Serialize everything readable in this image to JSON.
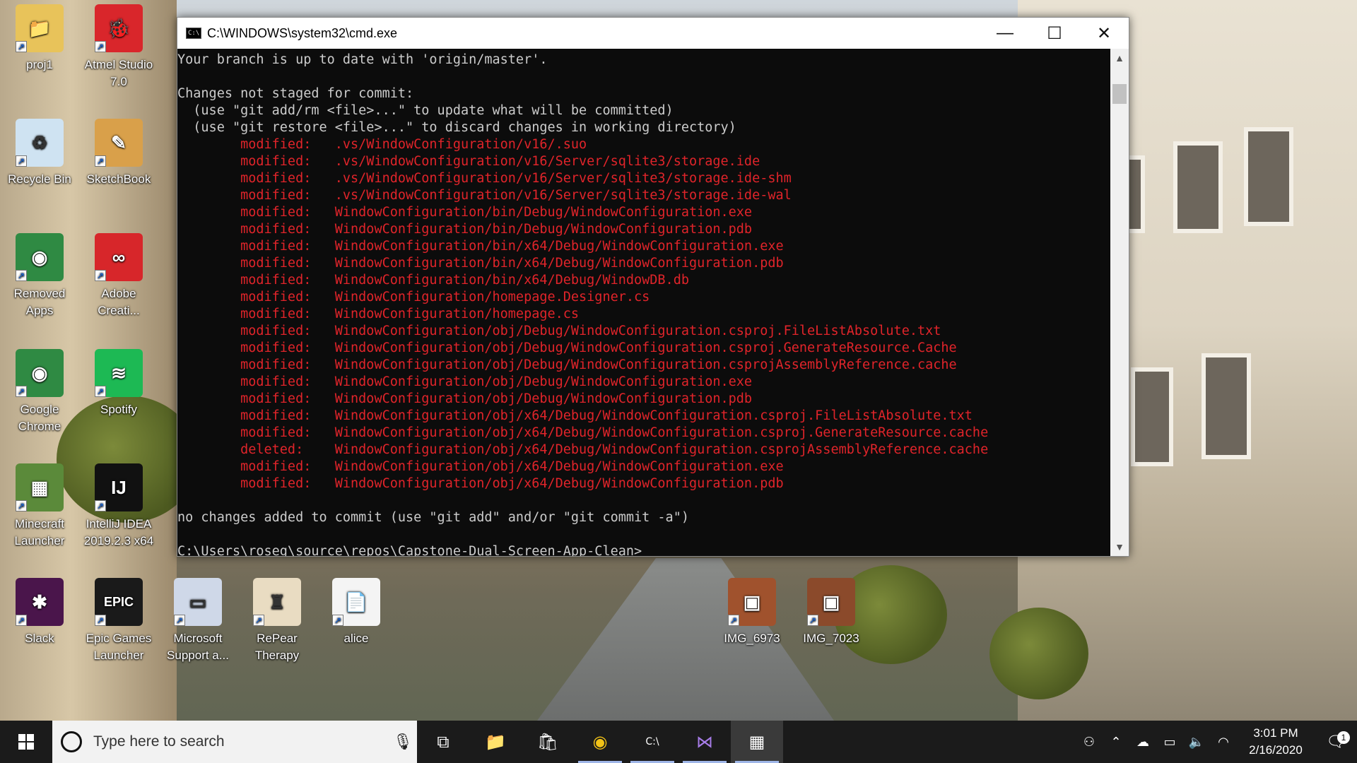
{
  "window": {
    "title": "C:\\WINDOWS\\system32\\cmd.exe",
    "minimize": "—",
    "maximize": "☐",
    "close": "✕"
  },
  "console_lines": [
    {
      "text": "Your branch is up to date with 'origin/master'.",
      "color": "gray"
    },
    {
      "text": "",
      "color": "gray"
    },
    {
      "text": "Changes not staged for commit:",
      "color": "gray"
    },
    {
      "text": "  (use \"git add/rm <file>...\" to update what will be committed)",
      "color": "gray"
    },
    {
      "text": "  (use \"git restore <file>...\" to discard changes in working directory)",
      "color": "gray"
    },
    {
      "text": "        modified:   .vs/WindowConfiguration/v16/.suo",
      "color": "red"
    },
    {
      "text": "        modified:   .vs/WindowConfiguration/v16/Server/sqlite3/storage.ide",
      "color": "red"
    },
    {
      "text": "        modified:   .vs/WindowConfiguration/v16/Server/sqlite3/storage.ide-shm",
      "color": "red"
    },
    {
      "text": "        modified:   .vs/WindowConfiguration/v16/Server/sqlite3/storage.ide-wal",
      "color": "red"
    },
    {
      "text": "        modified:   WindowConfiguration/bin/Debug/WindowConfiguration.exe",
      "color": "red"
    },
    {
      "text": "        modified:   WindowConfiguration/bin/Debug/WindowConfiguration.pdb",
      "color": "red"
    },
    {
      "text": "        modified:   WindowConfiguration/bin/x64/Debug/WindowConfiguration.exe",
      "color": "red"
    },
    {
      "text": "        modified:   WindowConfiguration/bin/x64/Debug/WindowConfiguration.pdb",
      "color": "red"
    },
    {
      "text": "        modified:   WindowConfiguration/bin/x64/Debug/WindowDB.db",
      "color": "red"
    },
    {
      "text": "        modified:   WindowConfiguration/homepage.Designer.cs",
      "color": "red"
    },
    {
      "text": "        modified:   WindowConfiguration/homepage.cs",
      "color": "red"
    },
    {
      "text": "        modified:   WindowConfiguration/obj/Debug/WindowConfiguration.csproj.FileListAbsolute.txt",
      "color": "red"
    },
    {
      "text": "        modified:   WindowConfiguration/obj/Debug/WindowConfiguration.csproj.GenerateResource.Cache",
      "color": "red"
    },
    {
      "text": "        modified:   WindowConfiguration/obj/Debug/WindowConfiguration.csprojAssemblyReference.cache",
      "color": "red"
    },
    {
      "text": "        modified:   WindowConfiguration/obj/Debug/WindowConfiguration.exe",
      "color": "red"
    },
    {
      "text": "        modified:   WindowConfiguration/obj/Debug/WindowConfiguration.pdb",
      "color": "red"
    },
    {
      "text": "        modified:   WindowConfiguration/obj/x64/Debug/WindowConfiguration.csproj.FileListAbsolute.txt",
      "color": "red"
    },
    {
      "text": "        modified:   WindowConfiguration/obj/x64/Debug/WindowConfiguration.csproj.GenerateResource.cache",
      "color": "red"
    },
    {
      "text": "        deleted:    WindowConfiguration/obj/x64/Debug/WindowConfiguration.csprojAssemblyReference.cache",
      "color": "red"
    },
    {
      "text": "        modified:   WindowConfiguration/obj/x64/Debug/WindowConfiguration.exe",
      "color": "red"
    },
    {
      "text": "        modified:   WindowConfiguration/obj/x64/Debug/WindowConfiguration.pdb",
      "color": "red"
    },
    {
      "text": "",
      "color": "gray"
    },
    {
      "text": "no changes added to commit (use \"git add\" and/or \"git commit -a\")",
      "color": "gray"
    },
    {
      "text": "",
      "color": "gray"
    },
    {
      "text": "C:\\Users\\roseg\\source\\repos\\Capstone-Dual-Screen-App-Clean>",
      "color": "gray"
    }
  ],
  "desktop_icons": [
    {
      "label": "proj1",
      "icon": "folder-icon",
      "color": "#e8c35a",
      "glyph": "📁"
    },
    {
      "label": "Atmel Studio 7.0",
      "icon": "atmel-studio-icon",
      "color": "#d9262b",
      "glyph": "🐞"
    },
    {
      "label": "Recycle Bin",
      "icon": "recycle-bin-icon",
      "color": "#cfe3f2",
      "glyph": "♻"
    },
    {
      "label": "SketchBook",
      "icon": "sketchbook-icon",
      "color": "#d9a04a",
      "glyph": "✎"
    },
    {
      "label": "Removed Apps",
      "icon": "chrome-icon",
      "color": "#2f8a43",
      "glyph": "◉"
    },
    {
      "label": "Adobe Creati...",
      "icon": "adobe-cc-icon",
      "color": "#d7262a",
      "glyph": "∞"
    },
    {
      "label": "Google Chrome",
      "icon": "chrome-icon",
      "color": "#2f8a43",
      "glyph": "◉"
    },
    {
      "label": "Spotify",
      "icon": "spotify-icon",
      "color": "#1db954",
      "glyph": "≋"
    },
    {
      "label": "Minecraft Launcher",
      "icon": "minecraft-icon",
      "color": "#5b8a3a",
      "glyph": "▦"
    },
    {
      "label": "IntelliJ IDEA 2019.2.3 x64",
      "icon": "intellij-icon",
      "color": "#111111",
      "glyph": "IJ"
    },
    {
      "label": "Slack",
      "icon": "slack-icon",
      "color": "#4a154b",
      "glyph": "✱"
    },
    {
      "label": "Epic Games Launcher",
      "icon": "epic-games-icon",
      "color": "#1a1a1a",
      "glyph": "EPIC"
    },
    {
      "label": "Microsoft Support a...",
      "icon": "ms-support-icon",
      "color": "#cfd8e8",
      "glyph": "▭"
    },
    {
      "label": "RePear Therapy",
      "icon": "repear-therapy-icon",
      "color": "#e9dcc2",
      "glyph": "♜"
    },
    {
      "label": "alice",
      "icon": "text-file-icon",
      "color": "#f4f4f4",
      "glyph": "📄"
    },
    {
      "label": "IMG_6973",
      "icon": "photo-icon",
      "color": "#a0522d",
      "glyph": "▣"
    },
    {
      "label": "IMG_7023",
      "icon": "photo-icon",
      "color": "#8b4a2b",
      "glyph": "▣"
    }
  ],
  "taskbar": {
    "search_placeholder": "Type here to search",
    "apps": [
      {
        "name": "task-view",
        "glyph": "⧉",
        "state": ""
      },
      {
        "name": "file-explorer",
        "glyph": "📁",
        "state": ""
      },
      {
        "name": "microsoft-store",
        "glyph": "🛍",
        "state": ""
      },
      {
        "name": "chrome",
        "glyph": "◉",
        "state": "running"
      },
      {
        "name": "command-prompt",
        "glyph": "C:\\",
        "state": "running"
      },
      {
        "name": "visual-studio",
        "glyph": "⋈",
        "state": "running"
      },
      {
        "name": "app",
        "glyph": "▦",
        "state": "active"
      }
    ],
    "time": "3:01 PM",
    "date": "2/16/2020",
    "notification_count": "1"
  },
  "colors": {
    "console_gray": "#cccccc",
    "console_red": "#e0242a",
    "taskbar": "#1b1b1b"
  }
}
